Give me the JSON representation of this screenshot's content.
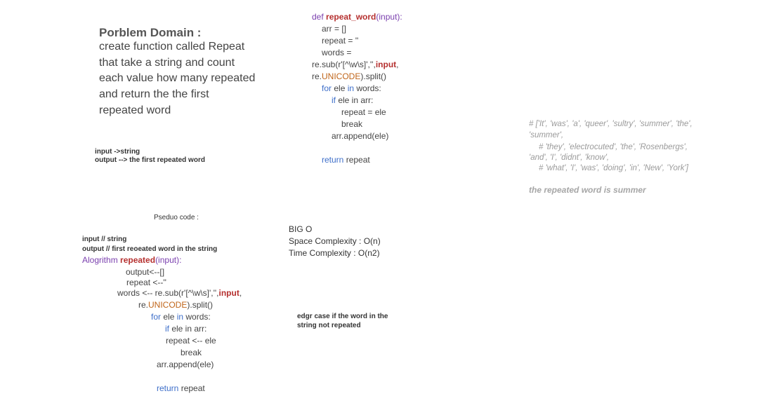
{
  "problem": {
    "title": "Porblem Domain :",
    "lines": [
      "create function called Repeat",
      "that take  a string and count",
      "each value how many repeated",
      "and return the the first",
      "repeated word"
    ]
  },
  "io": {
    "input": "input ->string",
    "output": "output --> the first repeated word"
  },
  "code": {
    "def_kw": "def",
    "func_name": "repeat_word",
    "func_args": "(input):",
    "arr": "arr = []",
    "repeat": "repeat = ''",
    "words": "words =",
    "resub_a": "re.sub(r'[^\\w\\s]',''",
    "resub_comma": ",",
    "resub_input": "input",
    "resub_end": ",",
    "re_prefix": "re.",
    "unicode": "UNICODE",
    "split": ").split()",
    "for_kw": "for",
    "ele_mid": " ele ",
    "in_kw": "in",
    "words_colon": " words:",
    "if_kw": "if",
    "if_rest": " ele  in arr:",
    "repeat_ele": "repeat = ele",
    "break_kw": "break",
    "append": "arr.append(ele)",
    "return_kw": "return",
    "return_val": " repeat"
  },
  "comments": {
    "line1": "#  ['It', 'was', 'a', 'queer', 'sultry', 'summer', 'the',",
    "line2": "'summer',",
    "line3": "# 'they', 'electrocuted', 'the', 'Rosenbergs',",
    "line4": "'and', 'I', 'didnt', 'know',",
    "line5": "# 'what', 'I', 'was', 'doing', 'in', 'New', 'York']",
    "summer": "the repeated word is summer"
  },
  "pseudo": {
    "title": "Pseduo code :",
    "input": "input // string",
    "output": "output // first  reoeated word in the string",
    "algo_kw": "Alogrithm",
    "algo_name": "repeated",
    "algo_args": "(input):",
    "output_line": "output<--[]",
    "repeat_line": "repeat <--''",
    "words_a": "words <-- re.sub(r'[^\\w\\s]',''",
    "words_comma": ",",
    "words_input": "input",
    "words_end": ",",
    "re_prefix": "re.",
    "unicode": "UNICODE",
    "split": ").split()",
    "for_kw": "for",
    "ele_mid": " ele ",
    "in_kw": "in",
    "words_colon": " words:",
    "if_kw": "if",
    "if_rest": " ele in arr:",
    "repeat_ele": "repeat <-- ele",
    "break_kw": "break",
    "append": "arr.append(ele)",
    "return_kw": "return",
    "return_val": " repeat"
  },
  "bigo": {
    "title": "BIG O",
    "space": "Space Complexity : O(n)",
    "time": "Time Complexity : O(n2)"
  },
  "edge_case": "edgr case if the word in the string not repeated"
}
